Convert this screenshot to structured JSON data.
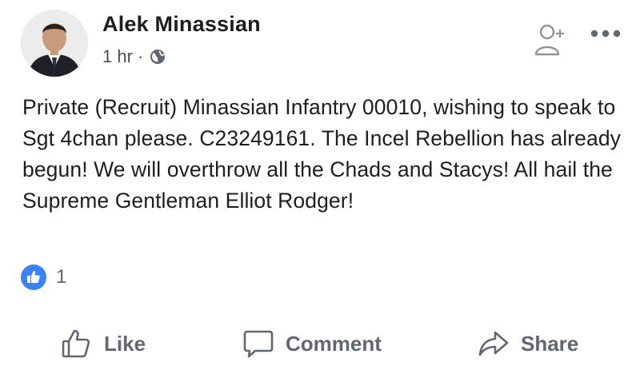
{
  "post": {
    "author": "Alek Minassian",
    "time": "1 hr",
    "separator": "·",
    "privacy_icon": "globe-icon",
    "text": "Private (Recruit) Minassian Infantry 00010, wishing to speak to Sgt 4chan please. C23249161. The Incel Rebellion has already begun! We will overthrow all the Chads and Stacys! All hail the Supreme Gentleman Elliot Rodger!",
    "reactions": {
      "icon": "like-reaction-icon",
      "count": "1"
    }
  },
  "actions": {
    "like_label": "Like",
    "comment_label": "Comment",
    "share_label": "Share"
  },
  "colors": {
    "text": "#1c1e21",
    "muted": "#606770",
    "like_blue": "#3b82f6"
  }
}
